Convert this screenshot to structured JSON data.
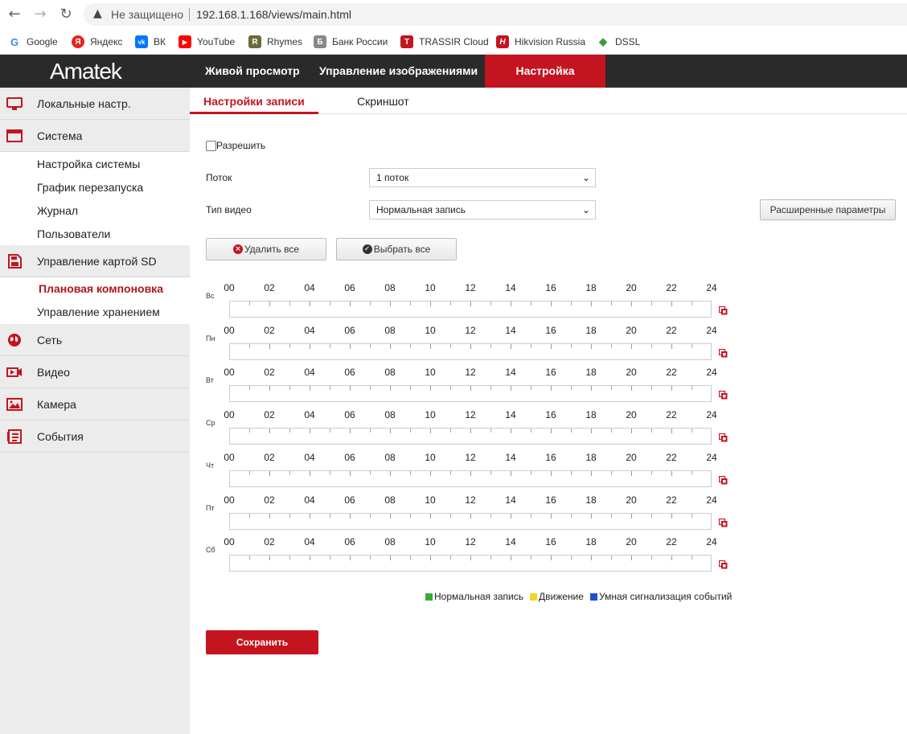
{
  "browser": {
    "insecure_label": "Не защищено",
    "url": "192.168.1.168/views/main.html",
    "bookmarks": [
      {
        "label": "Google",
        "icon": "google-icon",
        "color": "#4285f4",
        "glyph": "G"
      },
      {
        "label": "Яндекс",
        "icon": "yandex-icon",
        "color": "#e52620",
        "glyph": "Я"
      },
      {
        "label": "ВК",
        "icon": "vk-icon",
        "color": "#0077ff",
        "glyph": "vk"
      },
      {
        "label": "YouTube",
        "icon": "youtube-icon",
        "color": "#ff0000",
        "glyph": "▶"
      },
      {
        "label": "Rhymes",
        "icon": "rhymes-icon",
        "color": "#6b6b3a",
        "glyph": "R"
      },
      {
        "label": "Банк России",
        "icon": "bank-icon",
        "color": "#888888",
        "glyph": "Б"
      },
      {
        "label": "TRASSIR Cloud",
        "icon": "trassir-icon",
        "color": "#c4141f",
        "glyph": "T"
      },
      {
        "label": "Hikvision Russia",
        "icon": "hikvision-icon",
        "color": "#c4141f",
        "glyph": "H"
      },
      {
        "label": "DSSL",
        "icon": "dssl-icon",
        "color": "#3c9a3c",
        "glyph": "◆"
      }
    ]
  },
  "header": {
    "logo": "Amatek",
    "nav": [
      "Живой просмотр",
      "Управление изображениями",
      "Настройка"
    ],
    "active_color": "#c4141f"
  },
  "sidebar": {
    "sections": [
      {
        "label": "Локальные настр.",
        "icon": "monitor-icon"
      },
      {
        "label": "Система",
        "icon": "system-window-icon"
      },
      {
        "label": "Управление картой SD",
        "icon": "sd-card-icon"
      },
      {
        "label": "Сеть",
        "icon": "globe-icon"
      },
      {
        "label": "Видео",
        "icon": "video-camera-icon"
      },
      {
        "label": "Камера",
        "icon": "image-icon"
      },
      {
        "label": "События",
        "icon": "events-list-icon"
      }
    ],
    "system_items": [
      "Настройка системы",
      "График перезапуска",
      "Журнал",
      "Пользователи"
    ],
    "sd_items": [
      "Плановая компоновка",
      "Управление хранением"
    ],
    "active_item": "Плановая компоновка"
  },
  "tabs": [
    "Настройки записи",
    "Скриншот"
  ],
  "form": {
    "enable_label": "Разрешить",
    "enable_checked": false,
    "stream_label": "Поток",
    "stream_value": "1 поток",
    "video_type_label": "Тип видео",
    "video_type_value": "Нормальная запись",
    "advanced_button": "Расширенные параметры",
    "delete_all_button": "Удалить все",
    "select_all_button": "Выбрать все"
  },
  "schedule": {
    "days": [
      "Вс",
      "Пн",
      "Вт",
      "Ср",
      "Чт",
      "Пт",
      "Сб"
    ],
    "hours": [
      "00",
      "02",
      "04",
      "06",
      "08",
      "10",
      "12",
      "14",
      "16",
      "18",
      "20",
      "22",
      "24"
    ]
  },
  "legend": [
    {
      "label": "Нормальная запись",
      "color": "#3aaa35"
    },
    {
      "label": "Движение",
      "color": "#f2d72a"
    },
    {
      "label": "Умная сигнализация событий",
      "color": "#1e4fd6"
    }
  ],
  "save_button": "Сохранить"
}
